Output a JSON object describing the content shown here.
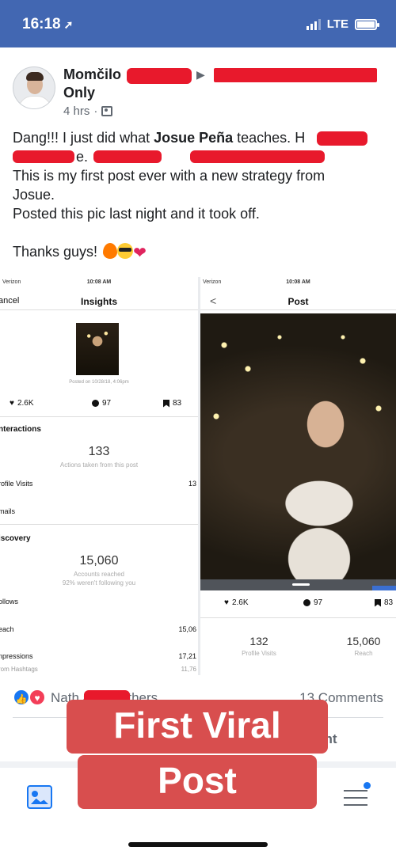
{
  "status_bar": {
    "time": "16:18",
    "nav_arrow": "➚",
    "network": "LTE"
  },
  "post": {
    "author": "Momčilo",
    "audience": "Only",
    "time_ago": "4 hrs",
    "text_lines": [
      {
        "pre": "Dang!!! I just did what ",
        "bold": "Josue Peña",
        "post": " teaches. H"
      },
      {
        "pre": "",
        "bold": "",
        "post": "+ v                nt + e                                e."
      },
      {
        "pre": "This is my first post ever with a new strategy from",
        "bold": "",
        "post": ""
      },
      {
        "pre": "Josue.",
        "bold": "",
        "post": ""
      },
      {
        "pre": "Posted this pic last night and it took off.",
        "bold": "",
        "post": ""
      },
      {
        "pre": "",
        "bold": "",
        "post": ""
      },
      {
        "pre": "Thanks guys! ",
        "bold": "",
        "post": ""
      }
    ]
  },
  "insights": {
    "status_carrier": "Verizon",
    "status_time": "10:08 AM",
    "cancel": "ancel",
    "title": "Insights",
    "posted_on": "Posted on 10/28/18, 4:06pm",
    "likes": "2.6K",
    "comments": "97",
    "saves": "83",
    "interactions_head": "nteractions",
    "actions_value": "133",
    "actions_label": "Actions taken from this post",
    "profile_visits_label": "rofile Visits",
    "profile_visits_value": "13",
    "emails_label": "mails",
    "discovery_head": "iscovery",
    "reach_value": "15,060",
    "reach_label": "Accounts reached",
    "not_following": "92% weren't following you",
    "follows_label": "ollows",
    "reach_row_label": "each",
    "reach_row_value": "15,06",
    "impressions_label": "npressions",
    "impressions_value": "17,21",
    "hashtags_label": "rom Hashtags",
    "hashtags_value": "11,76"
  },
  "post_view": {
    "status_carrier": "Verizon",
    "status_time": "10:08 AM",
    "title": "Post",
    "back": "<",
    "likes": "2.6K",
    "comments": "97",
    "saves": "83",
    "profile_visits_value": "132",
    "profile_visits_label": "Profile Visits",
    "reach_value": "15,060",
    "reach_label": "Reach"
  },
  "reactions": {
    "reactors": "Nath                and 9 others",
    "comments": "13 Comments",
    "action_partial": "ent"
  },
  "overlay": {
    "line1": "First Viral",
    "line2": "Post"
  },
  "colors": {
    "facebook_blue": "#4267b2",
    "overlay_red": "#d84e4e",
    "redaction_red": "#e8192c"
  },
  "battery_level": 1.0
}
